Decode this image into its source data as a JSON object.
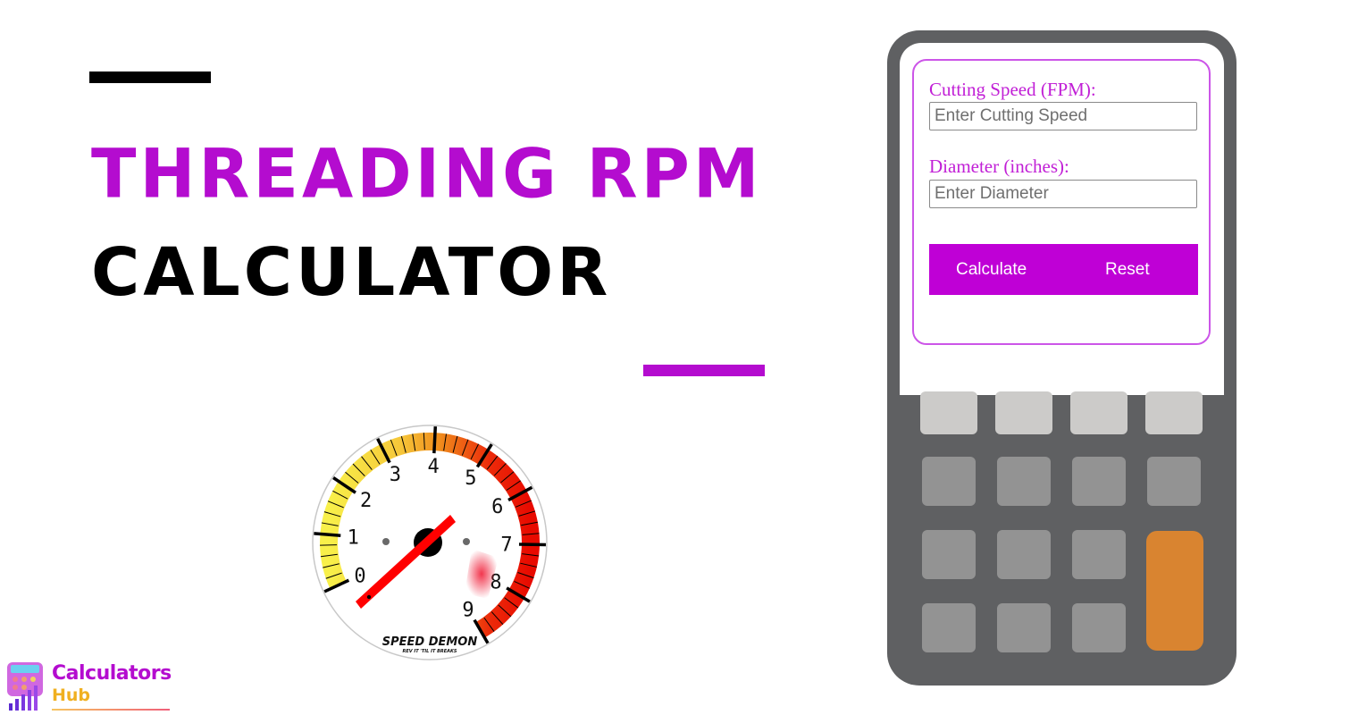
{
  "hero": {
    "title_line1": "THREADING RPM",
    "title_line2": "CALCULATOR",
    "accent_color": "#b40ccf"
  },
  "gauge": {
    "dial_labels": [
      "0",
      "1",
      "2",
      "3",
      "4",
      "5",
      "6",
      "7",
      "8",
      "9"
    ],
    "brand": "SPEED DEMON",
    "tagline": "REV IT 'TIL IT BREAKS"
  },
  "logo": {
    "line1": "Calculators",
    "line2": "Hub"
  },
  "calculator": {
    "fields": [
      {
        "label": "Cutting Speed (FPM):",
        "placeholder": "Enter Cutting Speed",
        "value": ""
      },
      {
        "label": "Diameter (inches):",
        "placeholder": "Enter Diameter",
        "value": ""
      }
    ],
    "buttons": {
      "calculate": "Calculate",
      "reset": "Reset"
    },
    "button_color": "#bf00d6",
    "keypad_accent": "#d98430"
  }
}
